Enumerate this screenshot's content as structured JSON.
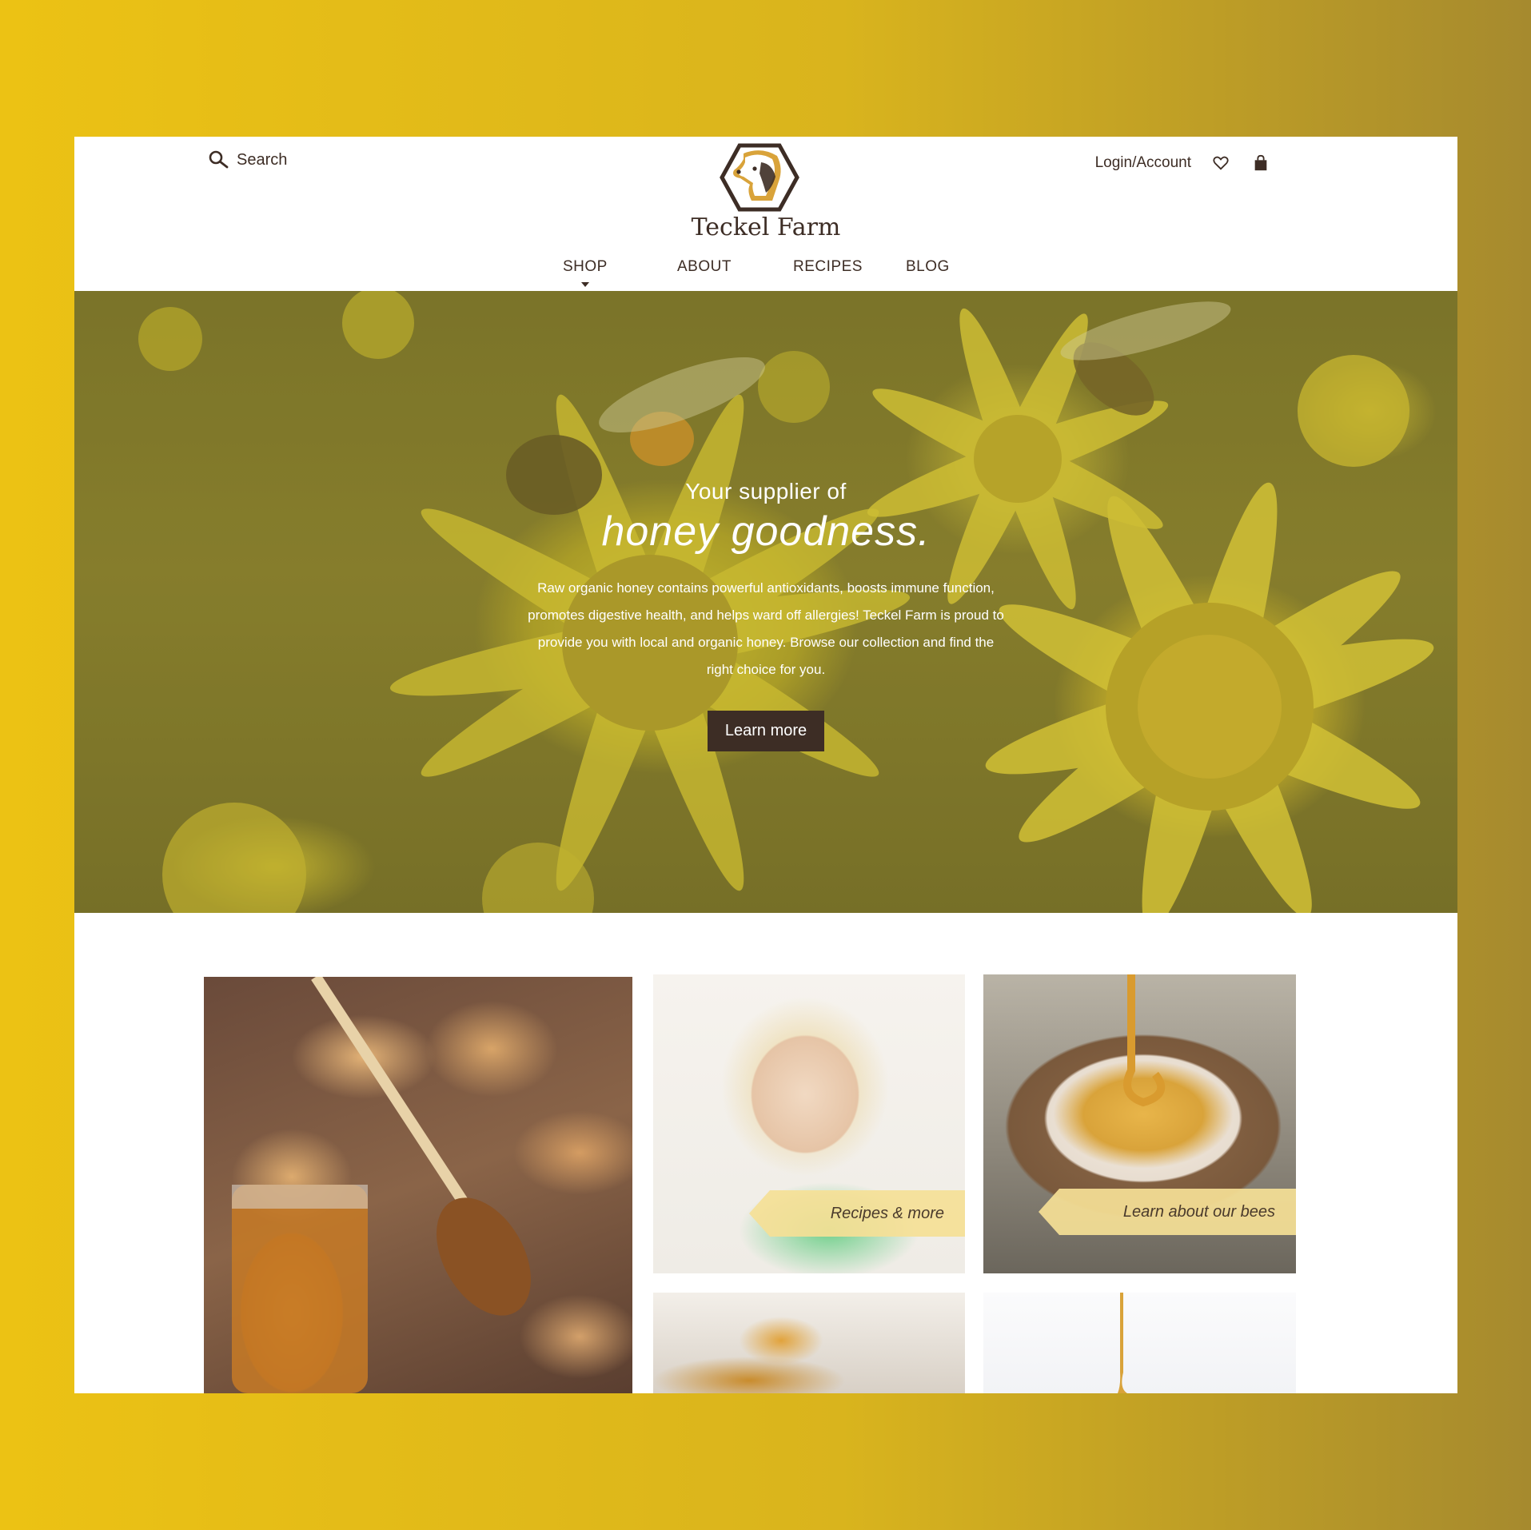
{
  "header": {
    "search_label": "Search",
    "brand": "Teckel Farm",
    "account_label": "Login/Account",
    "icons": [
      "search-icon",
      "logo-dog-hexagon-icon",
      "heart-icon",
      "shopping-bag-icon"
    ],
    "nav": [
      "SHOP",
      "ABOUT",
      "RECIPES",
      "BLOG"
    ],
    "nav_active": "SHOP"
  },
  "hero": {
    "kicker": "Your supplier of",
    "headline": "honey goodness.",
    "body": "Raw organic honey contains powerful antioxidants, boosts immune function, promotes digestive health, and helps ward off allergies! Teckel Farm is proud to provide you with local and organic honey. Browse our collection and find the right choice for you.",
    "cta": "Learn more"
  },
  "tiles": {
    "recipes_label": "Recipes & more",
    "bees_label": "Learn about our bees"
  },
  "colors": {
    "brand_brown": "#3d2d25",
    "honey_gold": "#d9a33a",
    "label_cream": "#f5e096"
  }
}
